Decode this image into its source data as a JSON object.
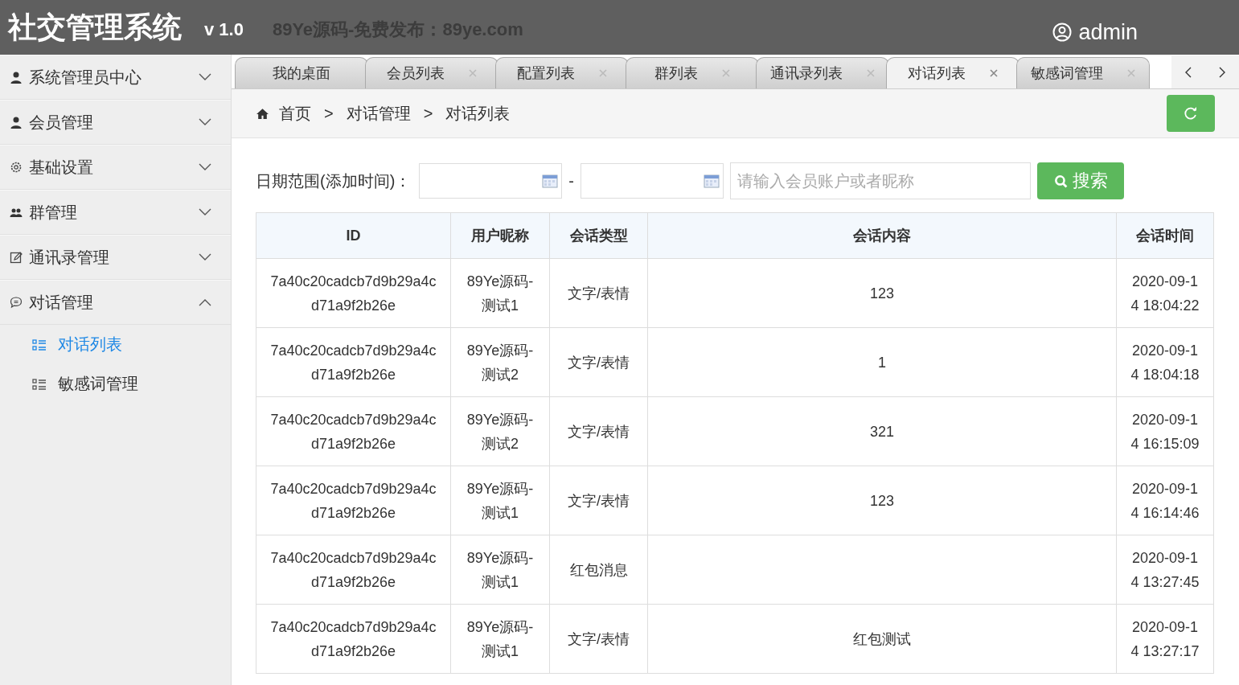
{
  "header": {
    "title": "社交管理系统",
    "version": "v 1.0",
    "slogan": "89Ye源码-免费发布：89ye.com",
    "user": "admin"
  },
  "sidebar": {
    "items": [
      {
        "label": "系统管理员中心",
        "kind": "user",
        "expanded": false
      },
      {
        "label": "会员管理",
        "kind": "user",
        "expanded": false
      },
      {
        "label": "基础设置",
        "kind": "gear",
        "expanded": false
      },
      {
        "label": "群管理",
        "kind": "group",
        "expanded": false
      },
      {
        "label": "通讯录管理",
        "kind": "edit",
        "expanded": false
      },
      {
        "label": "对话管理",
        "kind": "chat",
        "expanded": true,
        "children": [
          {
            "label": "对话列表",
            "selected": true
          },
          {
            "label": "敏感词管理",
            "selected": false
          }
        ]
      }
    ]
  },
  "tabs": [
    {
      "label": "我的桌面",
      "selected": false,
      "closable": false
    },
    {
      "label": "会员列表",
      "selected": false,
      "closable": true
    },
    {
      "label": "配置列表",
      "selected": false,
      "closable": true
    },
    {
      "label": "群列表",
      "selected": false,
      "closable": true
    },
    {
      "label": "通讯录列表",
      "selected": false,
      "closable": true
    },
    {
      "label": "对话列表",
      "selected": true,
      "closable": true
    },
    {
      "label": "敏感词管理",
      "selected": false,
      "closable": true
    }
  ],
  "breadcrumb": [
    "首页",
    "对话管理",
    "对话列表"
  ],
  "breadcrumb_separator": ">",
  "filter": {
    "label": "日期范围(添加时间)：",
    "range_separator": "-",
    "search_placeholder": "请输入会员账户或者昵称",
    "search_button": "搜索"
  },
  "table": {
    "columns": [
      "ID",
      "用户昵称",
      "会话类型",
      "会话内容",
      "会话时间"
    ],
    "rows": [
      [
        "7a40c20cadcb7d9b29a4cd71a9f2b26e",
        "89Ye源码-测试1",
        "文字/表情",
        "123",
        "2020-09-14 18:04:22"
      ],
      [
        "7a40c20cadcb7d9b29a4cd71a9f2b26e",
        "89Ye源码-测试2",
        "文字/表情",
        "1",
        "2020-09-14 18:04:18"
      ],
      [
        "7a40c20cadcb7d9b29a4cd71a9f2b26e",
        "89Ye源码-测试2",
        "文字/表情",
        "321",
        "2020-09-14 16:15:09"
      ],
      [
        "7a40c20cadcb7d9b29a4cd71a9f2b26e",
        "89Ye源码-测试1",
        "文字/表情",
        "123",
        "2020-09-14 16:14:46"
      ],
      [
        "7a40c20cadcb7d9b29a4cd71a9f2b26e",
        "89Ye源码-测试1",
        "红包消息",
        "",
        "2020-09-14 13:27:45"
      ],
      [
        "7a40c20cadcb7d9b29a4cd71a9f2b26e",
        "89Ye源码-测试1",
        "文字/表情",
        "红包测试",
        "2020-09-14 13:27:17"
      ]
    ]
  }
}
